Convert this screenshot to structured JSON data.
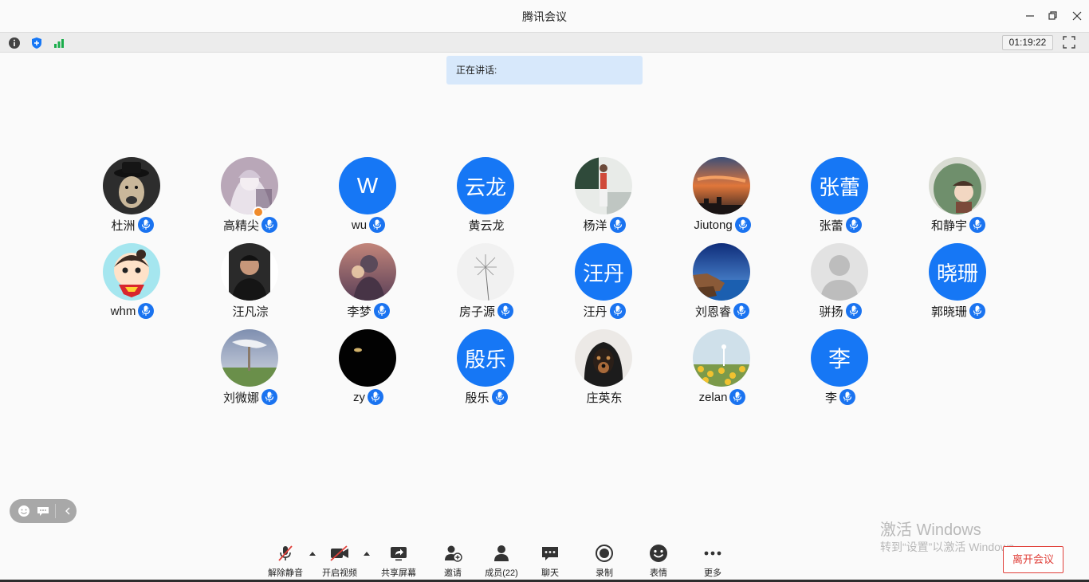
{
  "window": {
    "title": "腾讯会议"
  },
  "infobar": {
    "timer": "01:19:22"
  },
  "speaking": {
    "label": "正在讲话:"
  },
  "participants": [
    {
      "name": "杜洲",
      "avatar_type": "photo",
      "avatar_desc": "dog-in-hat"
    },
    {
      "name": "高精尖",
      "avatar_type": "photo",
      "avatar_desc": "anime",
      "host": true
    },
    {
      "name": "wu",
      "avatar_type": "text",
      "avatar_text": "W"
    },
    {
      "name": "黄云龙",
      "avatar_type": "text",
      "avatar_text": "云龙",
      "mic": false
    },
    {
      "name": "杨洋",
      "avatar_type": "photo",
      "avatar_desc": "person-standing"
    },
    {
      "name": "Jiutong",
      "avatar_type": "photo",
      "avatar_desc": "sunset"
    },
    {
      "name": "张蕾",
      "avatar_type": "text",
      "avatar_text": "张蕾"
    },
    {
      "name": "和静宇",
      "avatar_type": "photo",
      "avatar_desc": "cartoon-green"
    },
    {
      "name": "whm",
      "avatar_type": "photo",
      "avatar_desc": "cartoon-superman"
    },
    {
      "name": "汪凡淙",
      "avatar_type": "photo",
      "avatar_desc": "person-portrait",
      "mic": false
    },
    {
      "name": "李梦",
      "avatar_type": "photo",
      "avatar_desc": "silhouette-sunset"
    },
    {
      "name": "房子源",
      "avatar_type": "photo",
      "avatar_desc": "dandelion"
    },
    {
      "name": "汪丹",
      "avatar_type": "text",
      "avatar_text": "汪丹"
    },
    {
      "name": "刘恩睿",
      "avatar_type": "photo",
      "avatar_desc": "coast-blue-sky"
    },
    {
      "name": "骈扬",
      "avatar_type": "photo",
      "avatar_desc": "default-user"
    },
    {
      "name": "郭晓珊",
      "avatar_type": "text",
      "avatar_text": "晓珊"
    },
    {
      "name": "刘微娜",
      "avatar_type": "photo",
      "avatar_desc": "field-sky"
    },
    {
      "name": "zy",
      "avatar_type": "photo",
      "avatar_desc": "black"
    },
    {
      "name": "殷乐",
      "avatar_type": "text",
      "avatar_text": "殷乐"
    },
    {
      "name": "庄英东",
      "avatar_type": "photo",
      "avatar_desc": "dog-hood",
      "mic": false
    },
    {
      "name": "zelan",
      "avatar_type": "photo",
      "avatar_desc": "sunflowers"
    },
    {
      "name": "李",
      "avatar_type": "text",
      "avatar_text": "李"
    }
  ],
  "watermark": {
    "line1": "激活 Windows",
    "line2": "转到“设置”以激活 Windows。"
  },
  "toolbar": {
    "unmute": "解除静音",
    "start_video": "开启视频",
    "share_screen": "共享屏幕",
    "invite": "邀请",
    "members": "成员(22)",
    "chat": "聊天",
    "record": "录制",
    "emoji": "表情",
    "more": "更多",
    "leave": "离开会议"
  },
  "colors": {
    "accent": "#1677f5",
    "leave": "#e0403a",
    "banner": "#d7e8fb"
  }
}
